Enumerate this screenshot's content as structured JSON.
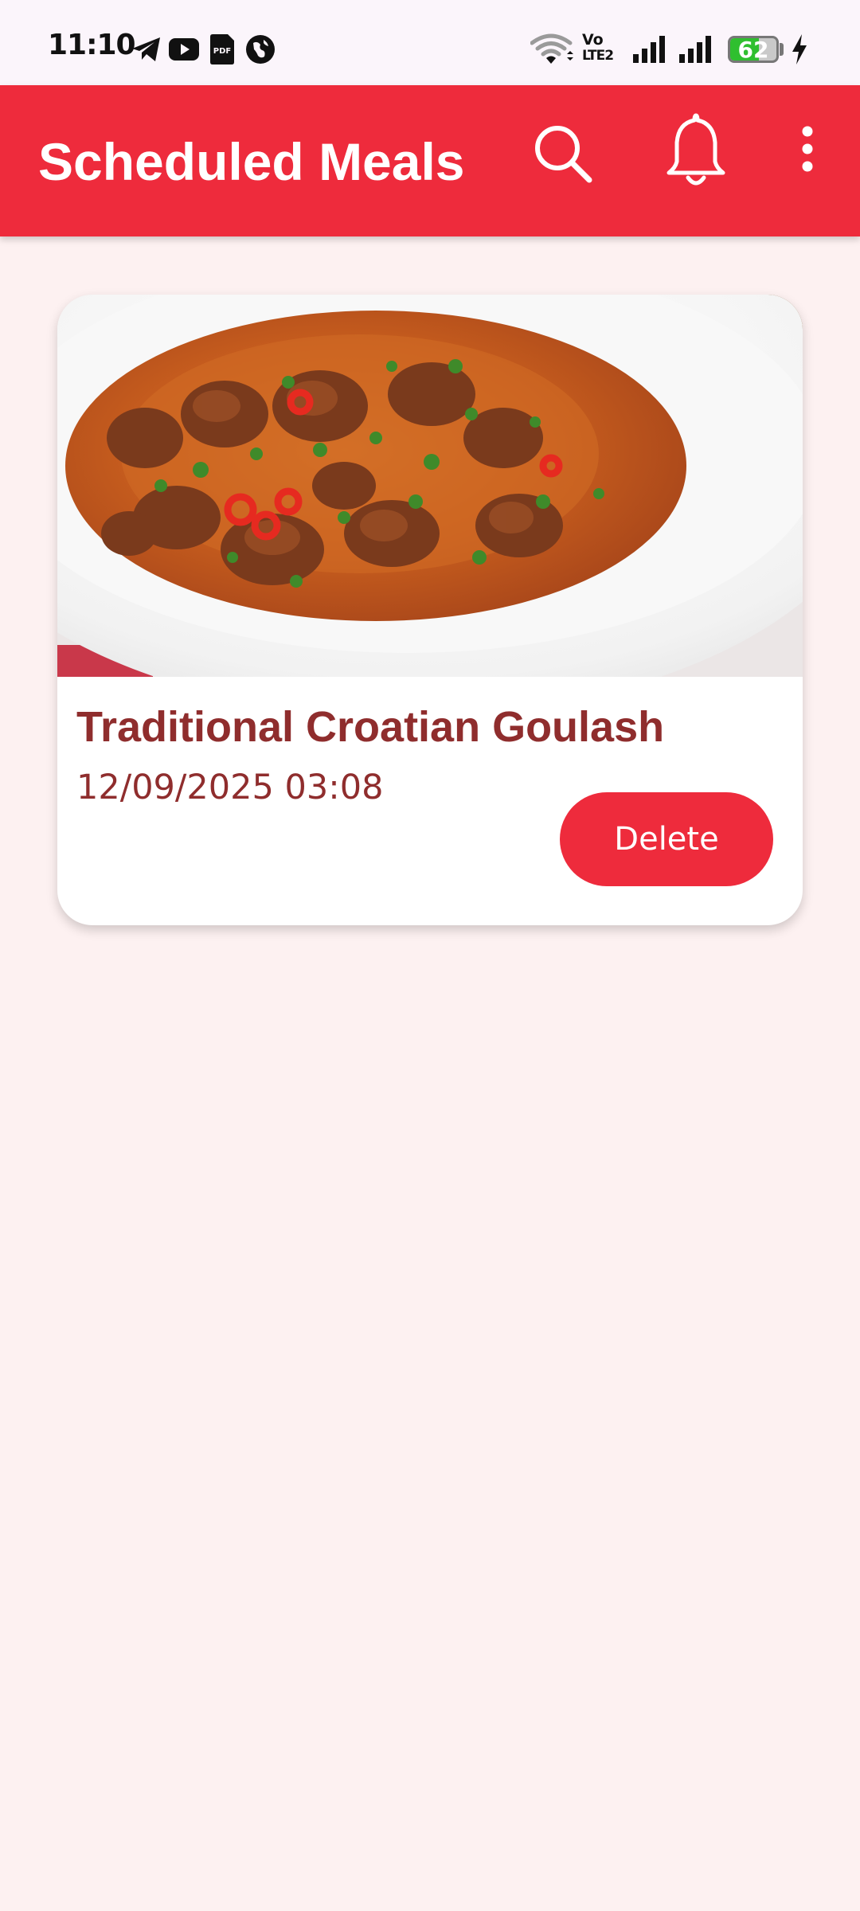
{
  "status_bar": {
    "time": "11:10",
    "left_icons": [
      "telegram-icon",
      "youtube-icon",
      "pdf-icon",
      "vpn-icon"
    ],
    "right_icons": [
      "wifi-icon",
      "volte-icon",
      "signal-icon",
      "signal-icon",
      "charging-icon"
    ],
    "volte_line1": "Vo",
    "volte_line2": "LTE2",
    "battery_level": "62",
    "battery_color": "#2fbf2f"
  },
  "app_bar": {
    "title": "Scheduled Meals",
    "background_color": "#ee2b3c",
    "actions": [
      "search-icon",
      "bell-icon",
      "more-vert-icon"
    ]
  },
  "meals": [
    {
      "title": "Traditional Croatian Goulash",
      "datetime": "12/09/2025 03:08",
      "delete_label": "Delete"
    }
  ],
  "colors": {
    "accent": "#ee2b3c",
    "text_dark_red": "#8f2d2d",
    "page_background": "#fdf1f1"
  }
}
